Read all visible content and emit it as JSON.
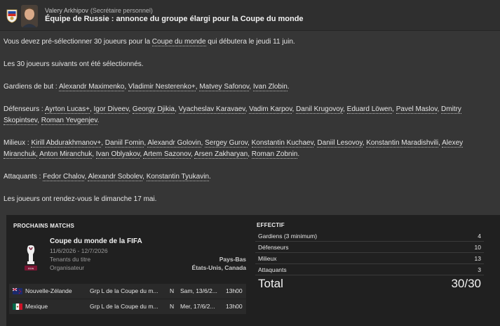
{
  "header": {
    "sender_name": "Valery Arkhipov",
    "sender_role": "(Secrétaire personnel)",
    "subject": "Équipe de Russie : annonce du groupe élargi pour la Coupe du monde",
    "crest_icon": "russia-federation-crest-icon",
    "avatar_icon": "staff-avatar"
  },
  "message": {
    "p1_a": "Vous devez pré-sélectionner 30 joueurs pour la ",
    "p1_link": "Coupe du monde",
    "p1_b": " qui débutera le jeudi 11 juin.",
    "p2": "Les 30 joueurs suivants ont été sélectionnés.",
    "goalkeepers_label": "Gardiens de but : ",
    "goalkeepers": [
      "Alexandr Maximenko",
      "Vladimir Nesterenko+",
      "Matvey Safonov",
      "Ivan Zlobin"
    ],
    "defenders_label": "Défenseurs : ",
    "defenders": [
      "Ayrton Lucas+",
      "Igor Diveev",
      "Georgy Djikia",
      "Vyacheslav Karavaev",
      "Vadim Karpov",
      "Danil Krugovoy",
      "Eduard Löwen",
      "Pavel Maslov",
      "Dmitry Skopintsev",
      "Roman Yevgenjev"
    ],
    "midfielders_label": "Milieux : ",
    "midfielders": [
      "Kirill Abdurakhmanov+",
      "Daniil Fomin",
      "Alexandr Golovin",
      "Sergey Gurov",
      "Konstantin Kuchaev",
      "Daniil Lesovoy",
      "Konstantin Maradishvili",
      "Alexey Miranchuk",
      "Anton Miranchuk",
      "Ivan Oblyakov",
      "Artem Sazonov",
      "Arsen Zakharyan",
      "Roman Zobnin"
    ],
    "attackers_label": "Attaquants : ",
    "attackers": [
      "Fedor Chalov",
      "Alexandr Sobolev",
      "Konstantin Tyukavin"
    ],
    "p_last": "Les joueurs ont rendez-vous le dimanche 17 mai."
  },
  "upcoming": {
    "title": "PROCHAINS MATCHS",
    "competition": {
      "name": "Coupe du monde de la FIFA",
      "dates": "11/6/2026 - 12/7/2026",
      "holder_label": "Tenants du titre",
      "holder_value": "Pays-Bas",
      "organizer_label": "Organisateur",
      "organizer_value": "États-Unis, Canada",
      "logo_icon": "fifa-world-cup-trophy-icon"
    },
    "matches": [
      {
        "team": "Nouvelle-Zélande",
        "flag": "new-zealand-flag-icon",
        "competition": "Grp L de la Coupe du m...",
        "venue": "N",
        "date": "Sam, 13/6/2...",
        "time": "13h00"
      },
      {
        "team": "Mexique",
        "flag": "mexico-flag-icon",
        "competition": "Grp L de la Coupe du m...",
        "venue": "N",
        "date": "Mer, 17/6/2...",
        "time": "13h00"
      }
    ]
  },
  "squad": {
    "title": "EFFECTIF",
    "rows": [
      {
        "label": "Gardiens (3 minimum)",
        "value": "4"
      },
      {
        "label": "Défenseurs",
        "value": "10"
      },
      {
        "label": "Milieux",
        "value": "13"
      },
      {
        "label": "Attaquants",
        "value": "3"
      }
    ],
    "total_label": "Total",
    "total_value": "30/30"
  },
  "colors": {
    "background": "#363636",
    "panel": "#202020",
    "header": "#2f2f2f"
  }
}
